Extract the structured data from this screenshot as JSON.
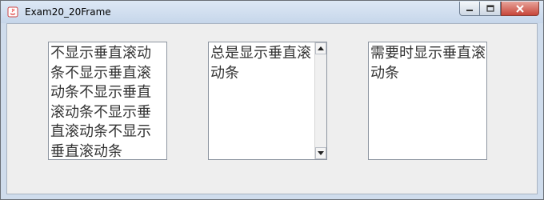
{
  "window": {
    "title": "Exam20_20Frame",
    "buttons": [
      "minimize-icon",
      "maximize-icon",
      "close-icon"
    ]
  },
  "textareas": [
    {
      "text": "不显示垂直滚动条不显示垂直滚动条不显示垂直滚动条不显示垂直滚动条不显示垂直滚动条",
      "scrollbar": "never"
    },
    {
      "text": "总是显示垂直滚动条",
      "scrollbar": "always"
    },
    {
      "text": "需要时显示垂直滚动条",
      "scrollbar": "as-needed"
    }
  ],
  "colors": {
    "frame_background": "#eeeeee",
    "textarea_background": "#ffffff",
    "text": "#333333"
  }
}
